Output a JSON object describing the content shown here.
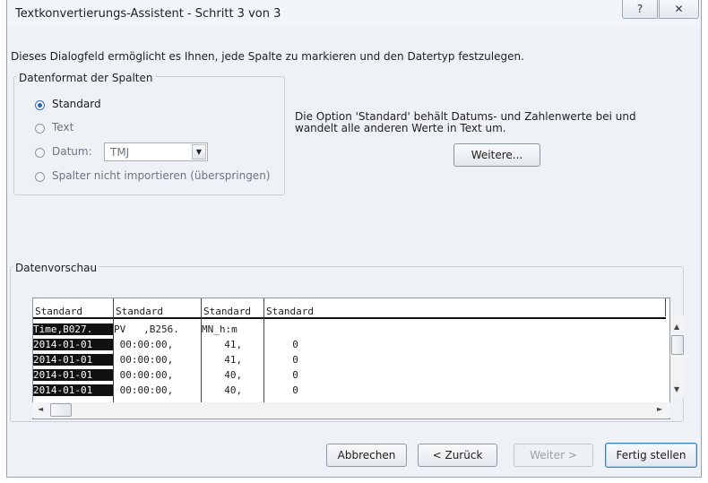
{
  "window": {
    "title": "Textkonvertierungs-Assistent - Schritt 3 von 3",
    "help_button": "?",
    "close_button": "✕"
  },
  "description": "Dieses Dialogfeld ermöglicht es Ihnen, jede Spalte zu markieren und den Datertyp festzulegen.",
  "column_format": {
    "label": "Datenformat der Spalten",
    "options": [
      {
        "label": "Standard",
        "selected": true
      },
      {
        "label": "Text",
        "selected": false
      },
      {
        "label": "Datum:",
        "selected": false
      },
      {
        "label": "Spalter nicht importieren (überspringen)",
        "selected": false
      }
    ],
    "date_format_value": "TMJ"
  },
  "info_text": "Die Option 'Standard' behält Datums- und Zahlenwerte bei und wandelt alle anderen Werte in Text um.",
  "more_button": "Weitere...",
  "preview": {
    "label": "Datenvorschau",
    "headers": [
      "Standard",
      "Standard",
      "Standard",
      "Standard"
    ],
    "rows": [
      [
        "Time,B027.",
        "PV   ,B256.",
        "MN_h:m",
        ""
      ],
      [
        "2014-01-01",
        " 00:00:00,",
        "  41,",
        "  0"
      ],
      [
        "2014-01-01",
        " 00:00:00,",
        "  41,",
        "  0"
      ],
      [
        "2014-01-01",
        " 00:00:00,",
        "  40,",
        "  0"
      ],
      [
        "2014-01-01",
        " 00:00:00,",
        "  40,",
        "  0"
      ]
    ]
  },
  "buttons": {
    "cancel": "Abbrechen",
    "back": "< Zurück",
    "next": "Weiter >",
    "finish": "Fertig stellen"
  },
  "scroll_icons": {
    "up": "▲",
    "down": "▼",
    "left": "◄",
    "right": "►",
    "dropdown": "▼"
  }
}
